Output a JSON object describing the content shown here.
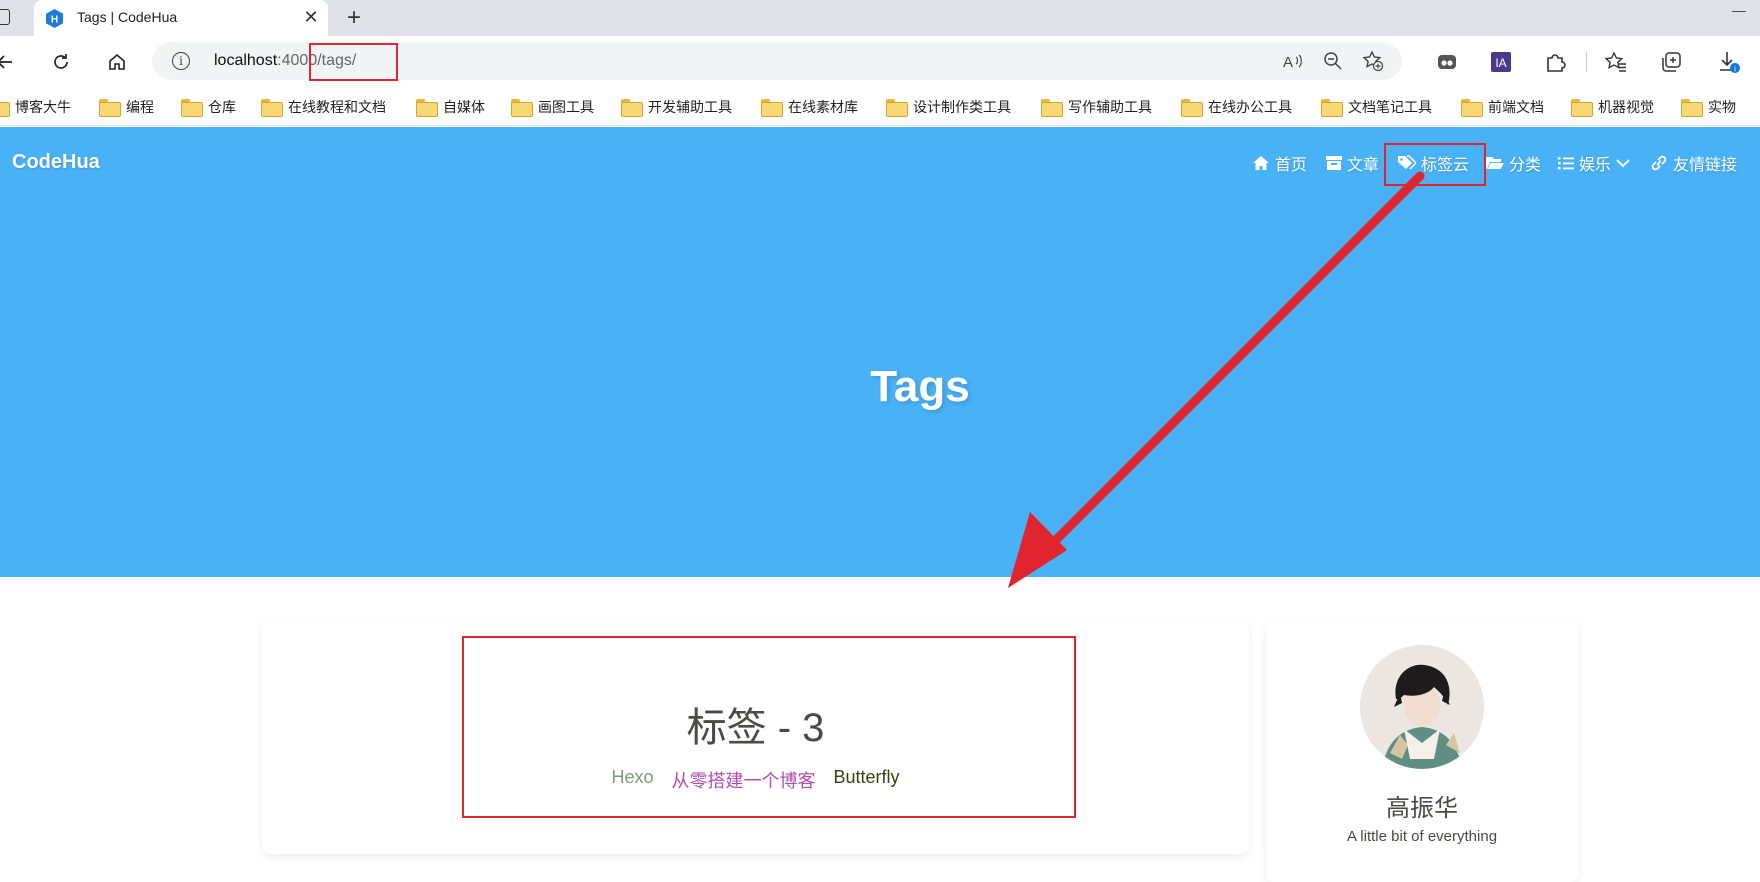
{
  "browser": {
    "tab_title": "Tags | CodeHua",
    "tab_close": "✕",
    "new_tab": "+",
    "window_minimize": "—",
    "address_host": "localhost",
    "address_port": ":4000",
    "address_path": "/tags/",
    "address_info": "i",
    "bookmarks": [
      "博客大牛",
      "编程",
      "仓库",
      "在线教程和文档",
      "自媒体",
      "画图工具",
      "开发辅助工具",
      "在线素材库",
      "设计制作类工具",
      "写作辅助工具",
      "在线办公工具",
      "文档笔记工具",
      "前端文档",
      "机器视觉",
      "实物"
    ],
    "toolbar_ia_label": "IA"
  },
  "site": {
    "name": "CodeHua",
    "menu": {
      "home": "首页",
      "archives": "文章",
      "tags": "标签云",
      "categories": "分类",
      "entertainment": "娱乐",
      "links": "友情链接"
    },
    "page_title": "Tags"
  },
  "tags_card": {
    "heading": "标签 - 3",
    "tags": [
      {
        "label": "Hexo",
        "color": "#7f9c76"
      },
      {
        "label": "从零搭建一个博客",
        "color": "#b04fb0"
      },
      {
        "label": "Butterfly",
        "color": "#3d3d13"
      }
    ]
  },
  "author_card": {
    "name": "高振华",
    "description": "A little bit of everything"
  },
  "colors": {
    "hero_bg": "#49b1f5",
    "annotation_red": "#e0252f"
  }
}
